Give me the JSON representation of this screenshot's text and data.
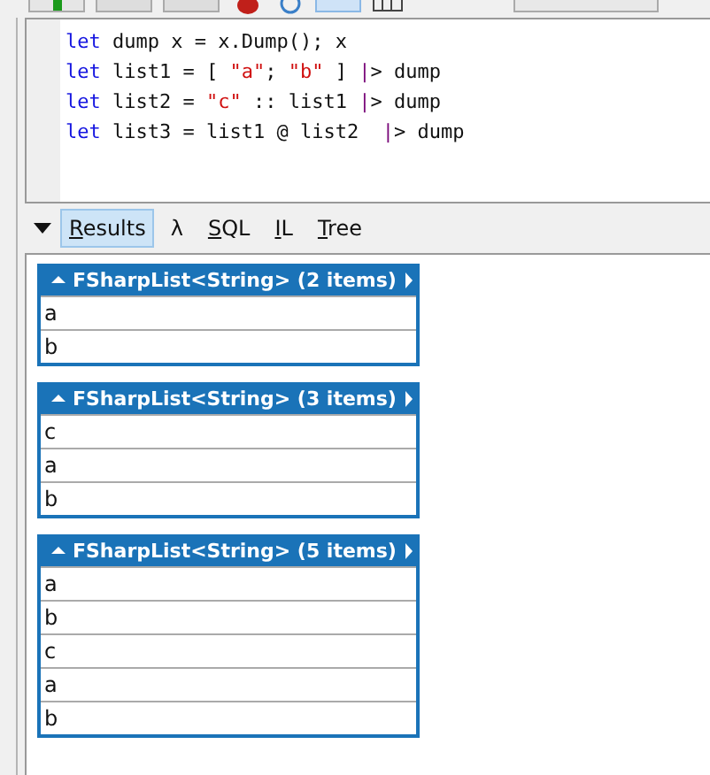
{
  "code_lines": [
    [
      {
        "kind": "kw",
        "text": "let"
      },
      {
        "kind": "plain",
        "text": " dump x = x.Dump(); x"
      }
    ],
    [
      {
        "kind": "kw",
        "text": "let"
      },
      {
        "kind": "plain",
        "text": " list1 = [ "
      },
      {
        "kind": "str",
        "text": "\"a\""
      },
      {
        "kind": "plain",
        "text": "; "
      },
      {
        "kind": "str",
        "text": "\"b\""
      },
      {
        "kind": "plain",
        "text": " ] "
      },
      {
        "kind": "pipe",
        "text": "|"
      },
      {
        "kind": "plain",
        "text": "> dump"
      }
    ],
    [
      {
        "kind": "kw",
        "text": "let"
      },
      {
        "kind": "plain",
        "text": " list2 = "
      },
      {
        "kind": "str",
        "text": "\"c\""
      },
      {
        "kind": "plain",
        "text": " :: list1 "
      },
      {
        "kind": "pipe",
        "text": "|"
      },
      {
        "kind": "plain",
        "text": "> dump"
      }
    ],
    [
      {
        "kind": "kw",
        "text": "let"
      },
      {
        "kind": "plain",
        "text": " list3 = list1 @ list2  "
      },
      {
        "kind": "pipe",
        "text": "|"
      },
      {
        "kind": "plain",
        "text": "> dump"
      }
    ]
  ],
  "output_tabs": [
    {
      "access": "R",
      "rest": "esults",
      "selected": true
    },
    {
      "rest": "λ",
      "selected": false
    },
    {
      "access": "S",
      "rest": "QL",
      "selected": false
    },
    {
      "access": "I",
      "rest": "L",
      "selected": false
    },
    {
      "access": "T",
      "rest": "ree",
      "selected": false
    }
  ],
  "results": [
    {
      "title": "FSharpList<String> (2 items)",
      "rows": [
        "a",
        "b"
      ]
    },
    {
      "title": "FSharpList<String> (3 items)",
      "rows": [
        "c",
        "a",
        "b"
      ]
    },
    {
      "title": "FSharpList<String> (5 items)",
      "rows": [
        "a",
        "b",
        "c",
        "a",
        "b"
      ]
    }
  ]
}
